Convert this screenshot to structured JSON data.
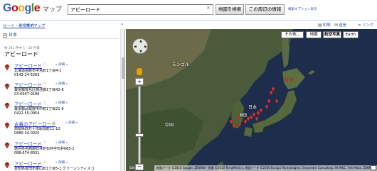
{
  "header": {
    "logo_text": "Google",
    "logo_sub": "マップ",
    "search_value": "アビーロード",
    "search_button": "地図を検索",
    "nearby_button": "この周辺の情報",
    "search_options": "検索オプション表示"
  },
  "toolbar": {
    "route": "ルート・乗換案内",
    "mymap": "マイマップ",
    "print": "印刷",
    "mail": "送信",
    "link": "リンク"
  },
  "panel": {
    "breadcrumb": "日本",
    "result_meta": "約 341 件中 1 - 10 件目",
    "result_title": "アビーロード",
    "results": [
      {
        "letter": "A",
        "name": "アビーロード",
        "more": "» 詳細 »",
        "address": "北海道函館市中島町1丁目4-1",
        "tel": "0143-24-5263"
      },
      {
        "letter": "B",
        "name": "アビーロード",
        "more": "» 詳細 »",
        "address": "東京都豊島区西池袋1丁目42-8",
        "tel": "03-6907-9188"
      },
      {
        "letter": "C",
        "name": "アビーロード",
        "more": "» 詳細 »",
        "address": "東京都武蔵野市中町1丁目21-9",
        "tel": "0422-55-0954"
      },
      {
        "letter": "D",
        "name": "古着のアビーロード",
        "more": "» 詳細 »",
        "address": "高知県四万十市駅前町11-10",
        "tel": "0880-34-0020"
      },
      {
        "letter": "E",
        "name": "アビーロード",
        "more": "» 詳細 »",
        "address": "徳島県名西郡石井町石井字石井665-1",
        "tel": "088-674-8031"
      },
      {
        "letter": "F",
        "name": "アビーロード",
        "more": "» 詳細 »",
        "address": "愛知県豊田市東山町1丁目5-1 グリーンシティスコ",
        "tel": ""
      }
    ]
  },
  "map": {
    "types": [
      "その他...",
      "地図",
      "航空写真",
      "Earth"
    ],
    "label_japan": "日本",
    "label_china": "中国",
    "label_korea": "韓国",
    "label_mongolia": "モンゴル",
    "footer": "地図データ ©2010 Google, ZENRIN - 画像 ©2010 TerraMetrics, 地図データ ©2010 Europa Technologies, Geocentre Consulting, SK M&C, Tele Atlas, ZENRIN - 利用規約",
    "scale": "500 km",
    "zoom_plus": "+",
    "zoom_minus": "−"
  },
  "colors": {
    "link": "#2a49b5",
    "pin": "#c0392b",
    "ocean": "#1e2d4c",
    "land": "#4a5a3a"
  }
}
